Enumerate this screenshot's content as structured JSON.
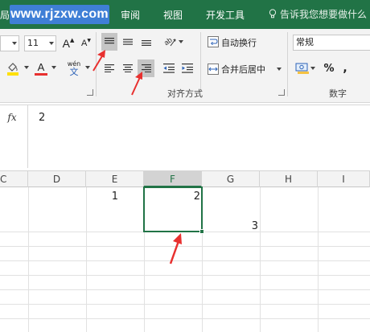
{
  "tabs": {
    "partial_left": "局",
    "review": "审阅",
    "view": "视图",
    "developer": "开发工具"
  },
  "watermark": "www.rjzxw.com",
  "tell_me": "告诉我您想要做什么",
  "font": {
    "size": "11",
    "grow_label": "A",
    "shrink_label": "A",
    "color_label": "A",
    "phonetic_top": "wén",
    "phonetic_bottom": "文"
  },
  "alignment": {
    "wrap_text": "自动换行",
    "merge_center": "合并后居中",
    "group_label": "对齐方式"
  },
  "number": {
    "format": "常规",
    "percent": "%",
    "comma": ",",
    "group_label": "数字"
  },
  "formula_bar": {
    "fx": "fx",
    "value": "2"
  },
  "columns": [
    "C",
    "D",
    "E",
    "F",
    "G",
    "H",
    "I"
  ],
  "active_column": "F",
  "cells": {
    "E1": "1",
    "F1": "2",
    "G2": "3"
  },
  "colors": {
    "accent": "#217346",
    "watermark": "#3f7fd6",
    "annotation": "#e8302f",
    "highlight": "#ffe000",
    "font_color": "#e8302f"
  }
}
